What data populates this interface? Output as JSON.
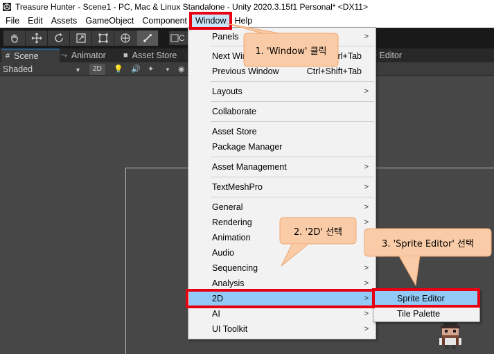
{
  "window": {
    "title": "Treasure Hunter - Scene1 - PC, Mac & Linux Standalone - Unity 2020.3.15f1 Personal* <DX11>",
    "icon": "unity-icon"
  },
  "menubar": {
    "items": [
      "File",
      "Edit",
      "Assets",
      "GameObject",
      "Component",
      "Window",
      "Help"
    ],
    "active": "Window"
  },
  "toolbar": {
    "tools": [
      "hand-tool-icon",
      "move-tool-icon",
      "rotate-tool-icon",
      "scale-tool-icon",
      "rect-tool-icon",
      "transform-tool-icon",
      "custom-tool-icon"
    ],
    "partial_button": "C"
  },
  "tabs": {
    "scene": "Scene",
    "animator": "Animator",
    "asset_store": "Asset Store",
    "sprite_editor_partial": "e Editor"
  },
  "scene_toolbar": {
    "shading_mode": "Shaded",
    "mode_2d": "2D"
  },
  "window_menu": {
    "items": [
      {
        "label": "Panels",
        "shortcut": "",
        "submenu": true
      },
      {
        "label": "Next Window",
        "shortcut": "Ctrl+Tab",
        "submenu": false
      },
      {
        "label": "Previous Window",
        "shortcut": "Ctrl+Shift+Tab",
        "submenu": false
      },
      {
        "label": "Layouts",
        "shortcut": "",
        "submenu": true
      },
      {
        "label": "Collaborate",
        "shortcut": "",
        "submenu": false
      },
      {
        "label": "Asset Store",
        "shortcut": "",
        "submenu": false
      },
      {
        "label": "Package Manager",
        "shortcut": "",
        "submenu": false
      },
      {
        "label": "Asset Management",
        "shortcut": "",
        "submenu": true
      },
      {
        "label": "TextMeshPro",
        "shortcut": "",
        "submenu": true
      },
      {
        "label": "General",
        "shortcut": "",
        "submenu": true
      },
      {
        "label": "Rendering",
        "shortcut": "",
        "submenu": true
      },
      {
        "label": "Animation",
        "shortcut": "",
        "submenu": true
      },
      {
        "label": "Audio",
        "shortcut": "",
        "submenu": true
      },
      {
        "label": "Sequencing",
        "shortcut": "",
        "submenu": true
      },
      {
        "label": "Analysis",
        "shortcut": "",
        "submenu": true
      },
      {
        "label": "2D",
        "shortcut": "",
        "submenu": true
      },
      {
        "label": "AI",
        "shortcut": "",
        "submenu": true
      },
      {
        "label": "UI Toolkit",
        "shortcut": "",
        "submenu": true
      }
    ],
    "highlighted": "2D"
  },
  "submenu_2d": {
    "items": [
      "Sprite Editor",
      "Tile Palette"
    ],
    "highlighted": "Sprite Editor"
  },
  "callouts": {
    "step1": "1. 'Window' 클릭",
    "step2": "2. '2D' 선택",
    "step3": "3. 'Sprite Editor' 선택"
  },
  "colors": {
    "highlight": "#e60012",
    "callout_fill": "#f9cba6",
    "callout_stroke": "#f0a673",
    "menu_hover": "#91c9f7",
    "editor_bg": "#474747"
  }
}
